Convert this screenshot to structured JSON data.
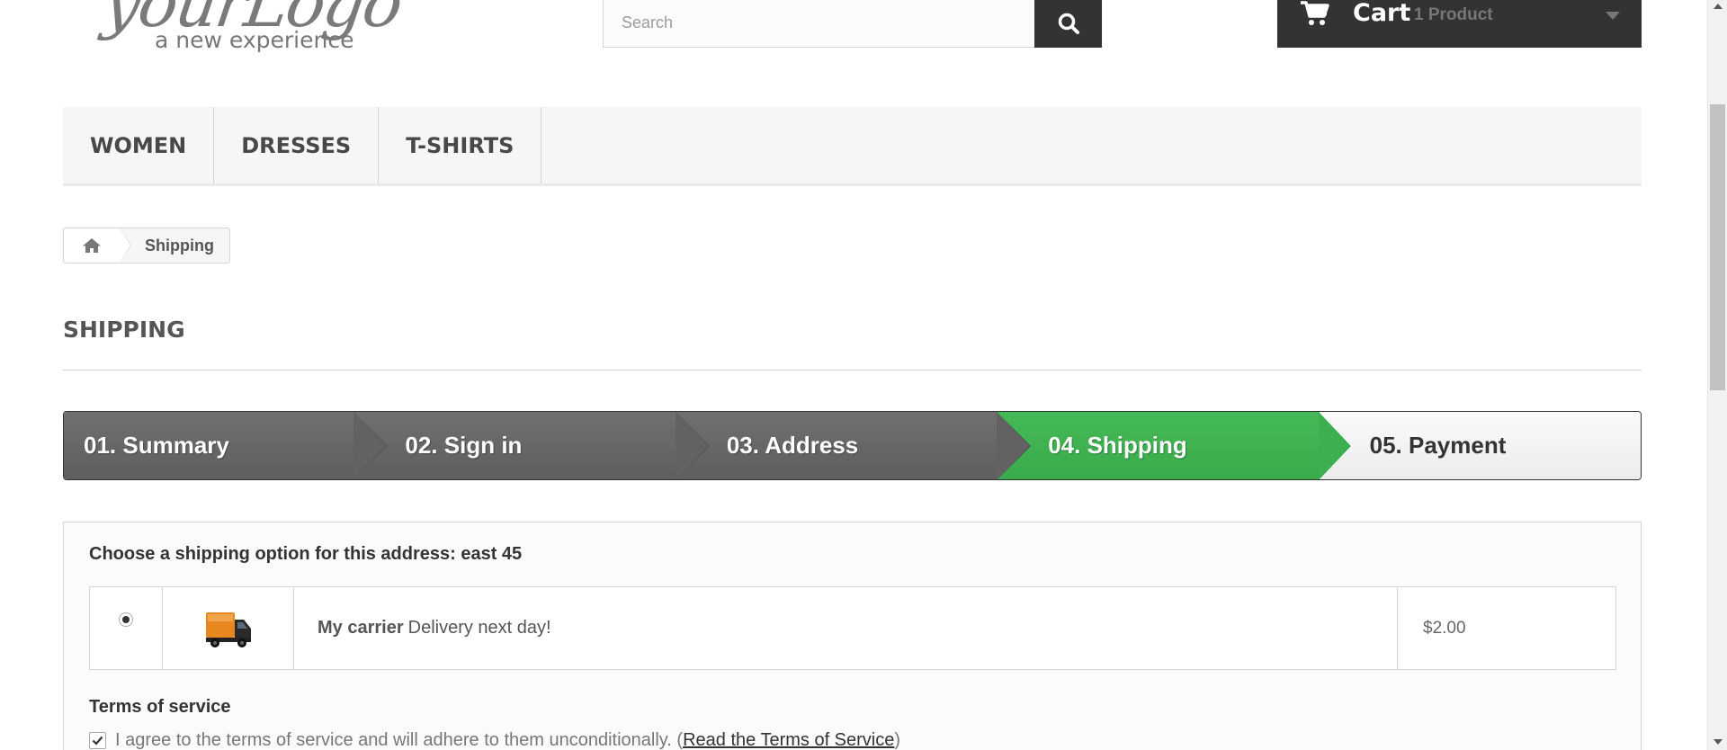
{
  "header": {
    "logo_script": "yourLogo",
    "logo_tagline": "a new experience",
    "search_placeholder": "Search",
    "cart_label": "Cart",
    "cart_count": "1 Product"
  },
  "menu": {
    "items": [
      "WOMEN",
      "DRESSES",
      "T-SHIRTS"
    ]
  },
  "breadcrumb": {
    "current": "Shipping"
  },
  "page_title": "SHIPPING",
  "steps": [
    {
      "label": "01. Summary",
      "state": "done"
    },
    {
      "label": "02. Sign in",
      "state": "done"
    },
    {
      "label": "03. Address",
      "state": "done"
    },
    {
      "label": "04. Shipping",
      "state": "current"
    },
    {
      "label": "05. Payment",
      "state": "todo"
    }
  ],
  "shipping": {
    "title": "Choose a shipping option for this address: east 45",
    "carrier": {
      "name": "My carrier",
      "delay": "Delivery next day!",
      "price": "$2.00",
      "selected": true
    },
    "tos_title": "Terms of service",
    "tos_text": "I agree to the terms of service and will adhere to them unconditionally. (",
    "tos_link": "Read the Terms of Service",
    "tos_close": ")",
    "tos_checked": true
  },
  "colors": {
    "dark": "#333333",
    "step_done": "#666666",
    "step_current": "#3eaf50",
    "step_todo": "#f2f2f2"
  }
}
